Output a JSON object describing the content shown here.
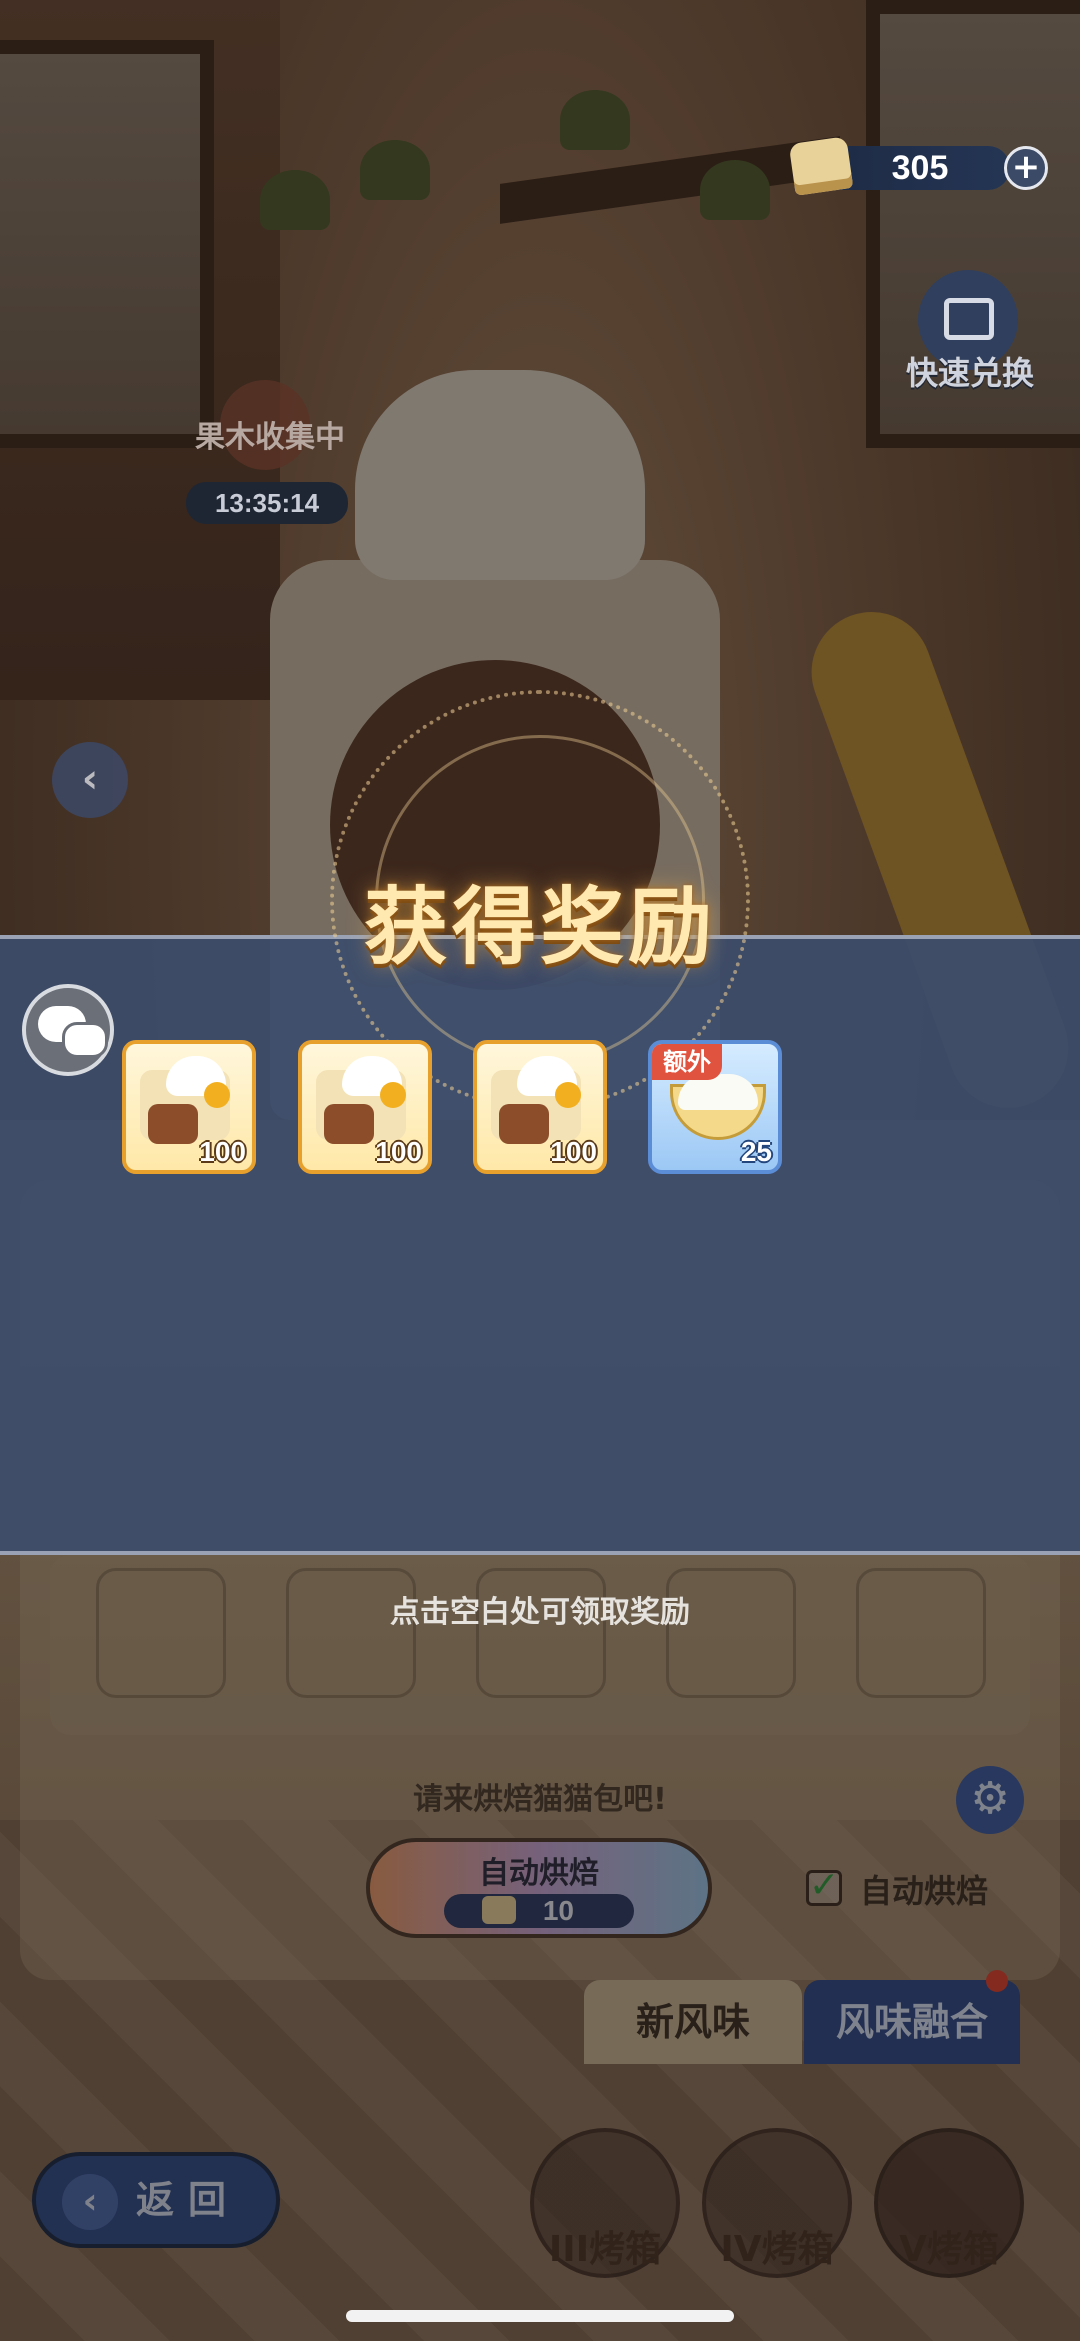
{
  "hud": {
    "currency_value": "305",
    "currency_plus": "+",
    "quick_exchange_label": "快速兑换",
    "collect_label": "果木收集中",
    "timer": "13:35:14"
  },
  "reward": {
    "title": "获得奖励",
    "items": [
      {
        "icon": "cat-bread-icon",
        "count": "100"
      },
      {
        "icon": "cat-bread-icon",
        "count": "100"
      },
      {
        "icon": "cat-bread-icon",
        "count": "100"
      },
      {
        "icon": "rice-bowl-icon",
        "count": "25",
        "tag": "额外"
      }
    ],
    "hint": "点击空白处可领取奖励"
  },
  "baking": {
    "prompt": "请来烘焙猫猫包吧!",
    "auto_button_label": "自动烘焙",
    "auto_button_cost": "10",
    "auto_checkbox_label": "自动烘焙",
    "checkbox_mark": "✓"
  },
  "tabs": {
    "new_flavor": "新风味",
    "flavor_fusion": "风味融合"
  },
  "nav": {
    "back_label": "返回",
    "back_arrow": "‹",
    "left_arrow": "‹",
    "ovens": [
      "III烤箱",
      "IV烤箱",
      "V烤箱"
    ]
  },
  "icons": {
    "settings": "⚙"
  },
  "colors": {
    "title_gold": "#ffe9b0",
    "band": "#3c4c6c",
    "bread_border": "#e8a02c",
    "rice_border": "#5b8dd6",
    "extra_tag": "#e0533e"
  }
}
